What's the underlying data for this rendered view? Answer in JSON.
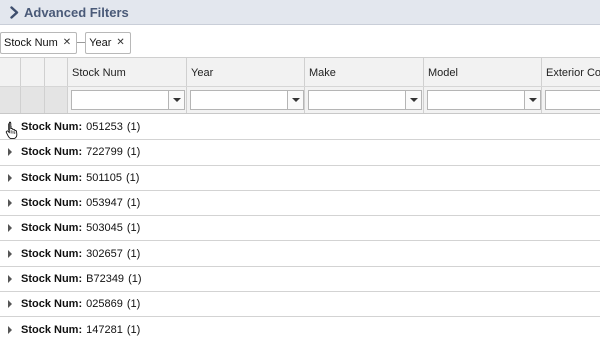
{
  "advanced_filters": {
    "title": "Advanced Filters"
  },
  "group_by": {
    "chips": [
      {
        "label": "Stock Num"
      },
      {
        "label": "Year"
      }
    ]
  },
  "grid": {
    "columns": [
      {
        "label": "Stock Num"
      },
      {
        "label": "Year"
      },
      {
        "label": "Make"
      },
      {
        "label": "Model"
      },
      {
        "label": "Exterior Col"
      }
    ],
    "group_rows": [
      {
        "label": "Stock Num:",
        "value": "051253",
        "count": "(1)"
      },
      {
        "label": "Stock Num:",
        "value": "722799",
        "count": "(1)"
      },
      {
        "label": "Stock Num:",
        "value": "501105",
        "count": "(1)"
      },
      {
        "label": "Stock Num:",
        "value": "053947",
        "count": "(1)"
      },
      {
        "label": "Stock Num:",
        "value": "503045",
        "count": "(1)"
      },
      {
        "label": "Stock Num:",
        "value": "302657",
        "count": "(1)"
      },
      {
        "label": "Stock Num:",
        "value": "B72349",
        "count": "(1)"
      },
      {
        "label": "Stock Num:",
        "value": "025869",
        "count": "(1)"
      },
      {
        "label": "Stock Num:",
        "value": "147281",
        "count": "(1)"
      }
    ]
  },
  "icons": {
    "expand": "chevron-right-icon",
    "chip_remove": "close-icon",
    "filter_dropdown": "caret-down-icon",
    "row_expander": "triangle-right-icon",
    "cursor": "hand-pointer-icon"
  },
  "colors": {
    "filter_bar_bg": "#e3e7ee",
    "filter_title": "#4a5a78",
    "header_bg": "#f2f2f2"
  }
}
